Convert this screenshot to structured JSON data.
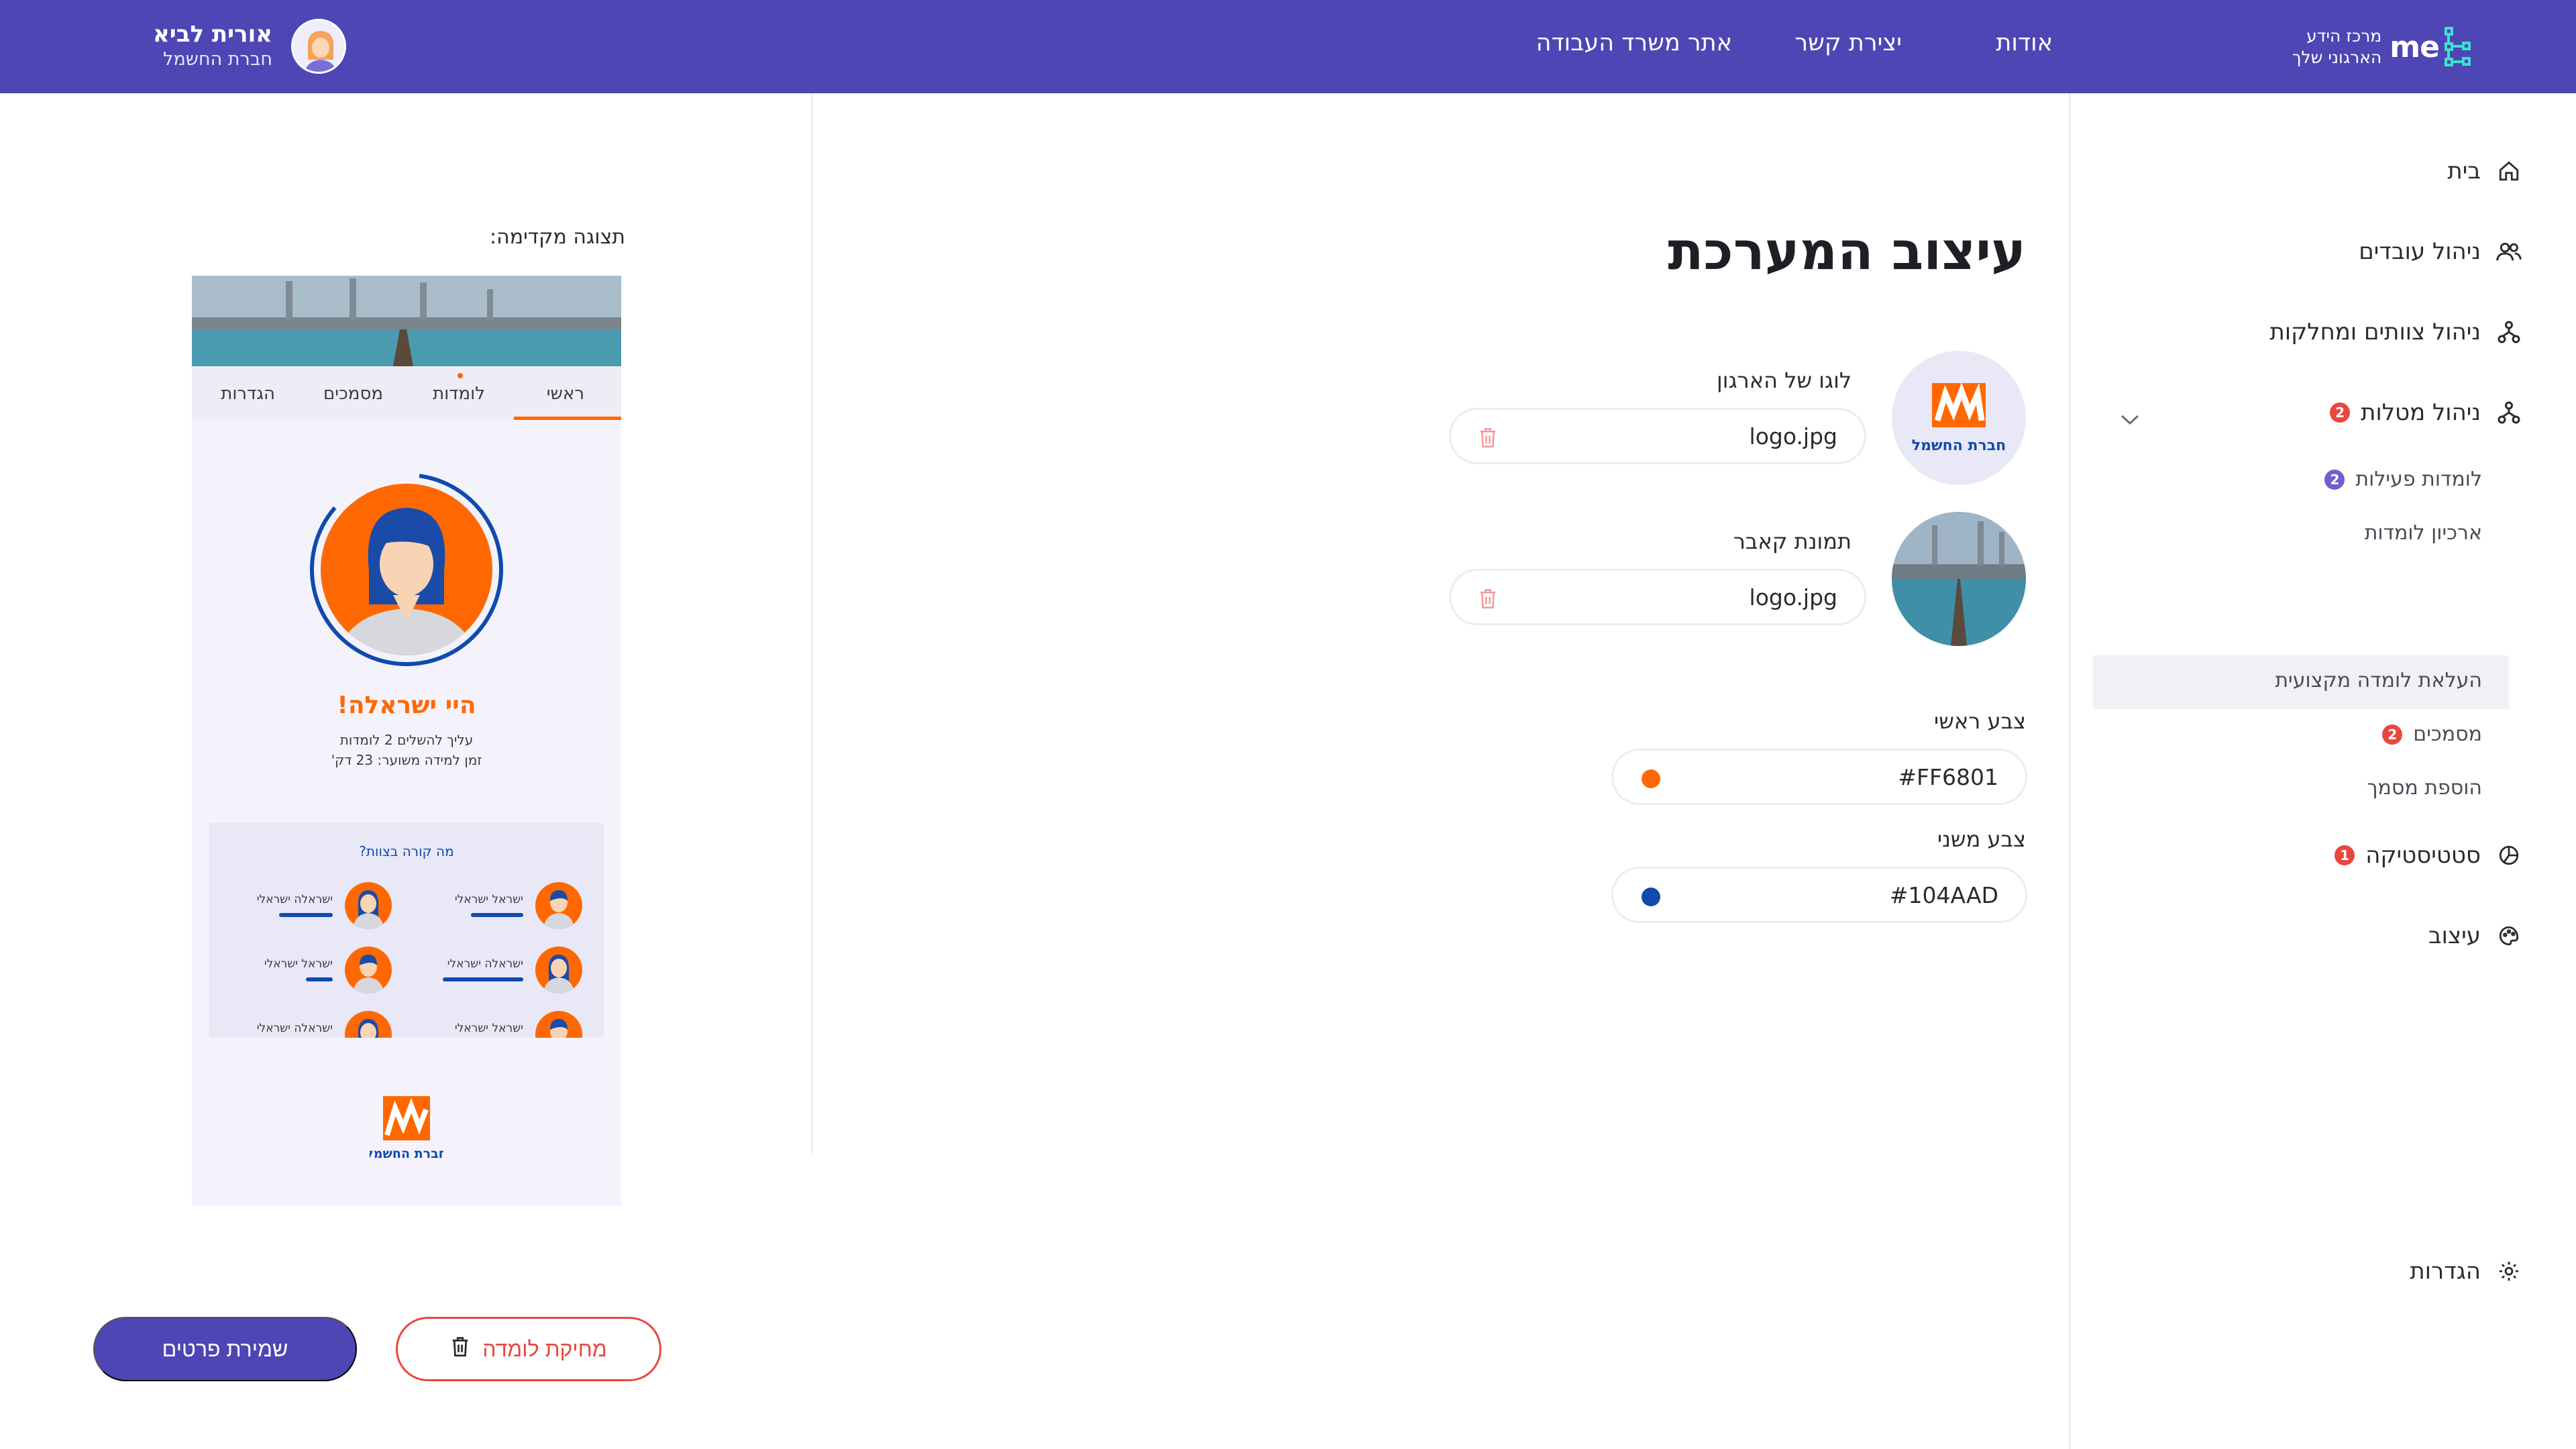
{
  "header": {
    "brand_line1": "מרכז הידע",
    "brand_line2": "הארגוני שלך",
    "brand_word": "me",
    "nav": [
      "אודות",
      "יצירת קשר",
      "אתר משרד העבודה"
    ],
    "user_name": "אורית לביא",
    "user_org": "חברת החשמל"
  },
  "sidebar": {
    "home": "בית",
    "employees": "ניהול עובדים",
    "teams": "ניהול צוותים ומחלקות",
    "tasks": "ניהול מטלות",
    "tasks_badge": "2",
    "sub_active_lomdot": "לומדות פעילות",
    "sub_active_badge": "2",
    "sub_archive": "ארכיון לומדות",
    "sub_upload": "העלאת לומדה מקצועית",
    "sub_docs": "מסמכים",
    "sub_docs_badge": "2",
    "sub_add_doc": "הוספת מסמך",
    "stats": "סטטיסטיקה",
    "stats_badge": "1",
    "design": "עיצוב",
    "settings": "הגדרות"
  },
  "form": {
    "title": "עיצוב המערכת",
    "logo_label": "לוגו של הארגון",
    "logo_file": "logo.jpg",
    "cover_label": "תמונת קאבר",
    "cover_file": "logo.jpg",
    "primary_label": "צבע ראשי",
    "primary_hex": "#FF6801",
    "secondary_label": "צבע משני",
    "secondary_hex": "#104AAD"
  },
  "logo_caption": "חברת החשמל",
  "preview": {
    "label": "תצוגה מקדימה:",
    "tabs": [
      "ראשי",
      "לומדות",
      "מסמכים",
      "הגדרות"
    ],
    "greeting": "היי ישראלה!",
    "line1": "עליך להשלים 2 לומדות",
    "line2": "זמן למידה משוער: 23 דק'",
    "team_title": "מה קורה בצוות?",
    "members": [
      "ישראל ישראלי",
      "ישראלה ישראלי",
      "ישראלה ישראלי",
      "ישראל ישראלי",
      "ישראל ישראלי",
      "ישראלה ישראלי"
    ]
  },
  "buttons": {
    "save": "שמירת פרטים",
    "delete": "מחיקת לומדה"
  },
  "colors": {
    "primary": "#FF6801",
    "secondary": "#104AAD",
    "header": "#4E46B4",
    "danger": "#E8473F"
  }
}
